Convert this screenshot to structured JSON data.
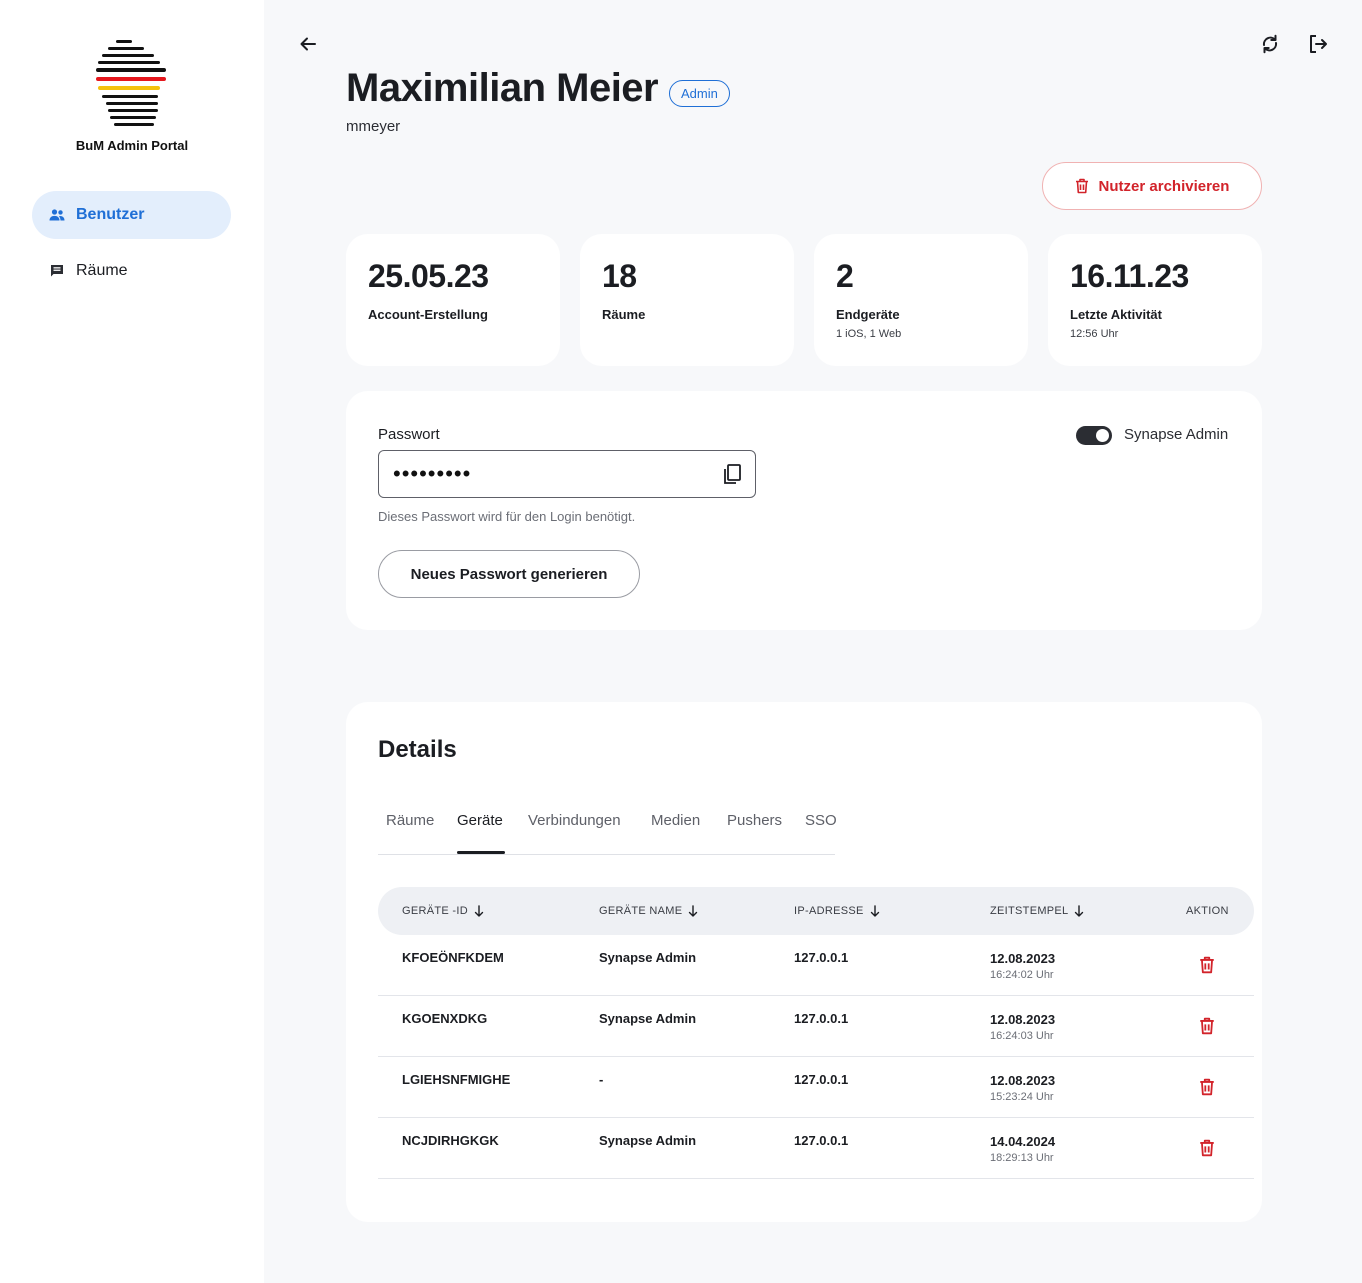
{
  "sidebar": {
    "logo_text": "BuM Admin Portal",
    "items": [
      {
        "label": "Benutzer",
        "icon": "users-icon",
        "active": true
      },
      {
        "label": "Räume",
        "icon": "chat-icon",
        "active": false
      }
    ]
  },
  "header": {
    "title": "Maximilian Meier",
    "badge": "Admin",
    "username": "mmeyer",
    "archive_label": "Nutzer archivieren"
  },
  "stats": [
    {
      "value": "25.05.23",
      "label": "Account-Erstellung",
      "sub": ""
    },
    {
      "value": "18",
      "label": "Räume",
      "sub": ""
    },
    {
      "value": "2",
      "label": "Endgeräte",
      "sub": "1 iOS,  1 Web"
    },
    {
      "value": "16.11.23",
      "label": "Letzte Aktivität",
      "sub": "12:56 Uhr"
    }
  ],
  "password": {
    "label": "Passwort",
    "masked": "•••••••••",
    "hint": "Dieses Passwort wird für den Login benötigt.",
    "generate_label": "Neues Passwort generieren",
    "toggle_label": "Synapse Admin",
    "toggle_on": true
  },
  "details": {
    "title": "Details",
    "tabs": [
      "Räume",
      "Geräte",
      "Verbindungen",
      "Medien",
      "Pushers",
      "SSO"
    ],
    "active_tab": "Geräte",
    "columns": [
      "GERÄTE -ID",
      "GERÄTE NAME",
      "IP-ADRESSE",
      "ZEITSTEMPEL",
      "AKTION"
    ],
    "rows": [
      {
        "id": "KFOEÖNFKDEM",
        "name": "Synapse Admin",
        "ip": "127.0.0.1",
        "date": "12.08.2023",
        "time": "16:24:02 Uhr"
      },
      {
        "id": "KGOENXDKG",
        "name": "Synapse Admin",
        "ip": "127.0.0.1",
        "date": "12.08.2023",
        "time": "16:24:03 Uhr"
      },
      {
        "id": "LGIEHSNFMIGHE",
        "name": "-",
        "ip": "127.0.0.1",
        "date": "12.08.2023",
        "time": "15:23:24 Uhr"
      },
      {
        "id": "NCJDIRHGKGK",
        "name": "Synapse Admin",
        "ip": "127.0.0.1",
        "date": "14.04.2024",
        "time": "18:29:13 Uhr"
      }
    ]
  },
  "colors": {
    "accent": "#1f6fd6",
    "danger": "#d2232a",
    "background": "#f7f8fa"
  }
}
